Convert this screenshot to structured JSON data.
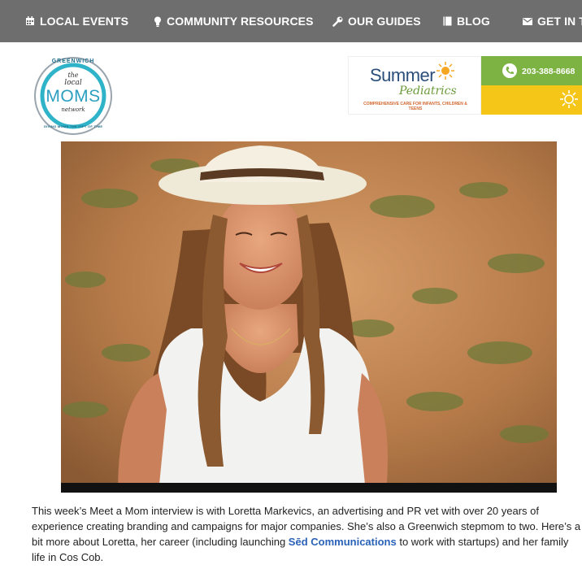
{
  "nav": {
    "items": [
      {
        "label": "LOCAL EVENTS",
        "icon": "calendar-icon"
      },
      {
        "label": "COMMUNITY RESOURCES",
        "icon": "lightbulb-icon"
      },
      {
        "label": "OUR GUIDES",
        "icon": "wrench-icon"
      },
      {
        "label": "BLOG",
        "icon": "book-icon"
      },
      {
        "label": "GET IN TO",
        "icon": "envelope-icon"
      }
    ]
  },
  "logo": {
    "top_text": "GREENWICH",
    "the": "the",
    "local": "local",
    "moms": "MOMS",
    "network": "network",
    "bottom_text": "GIVING MOMS THE GIFT OF TIME"
  },
  "ad": {
    "brand_line1": "Summer",
    "brand_line2": "Pediatrics",
    "tagline": "COMPREHENSIVE CARE FOR INFANTS, CHILDREN & TEENS",
    "phone": "203-388-8668",
    "colors": {
      "green": "#7cb342",
      "yellow": "#f5c518",
      "navy": "#2b4f7a",
      "orange": "#d2662e"
    }
  },
  "article": {
    "p1": "This week’s Meet a Mom interview is with Loretta Markevics, an advertising and PR vet with over 20 years of experience creating branding and campaigns for major companies. She’s also a Greenwich stepmom to two. Here’s a bit more about Loretta, her career (including launching ",
    "link": "Sēd Communications",
    "p2": " to work with startups) and her family life in Cos Cob."
  }
}
